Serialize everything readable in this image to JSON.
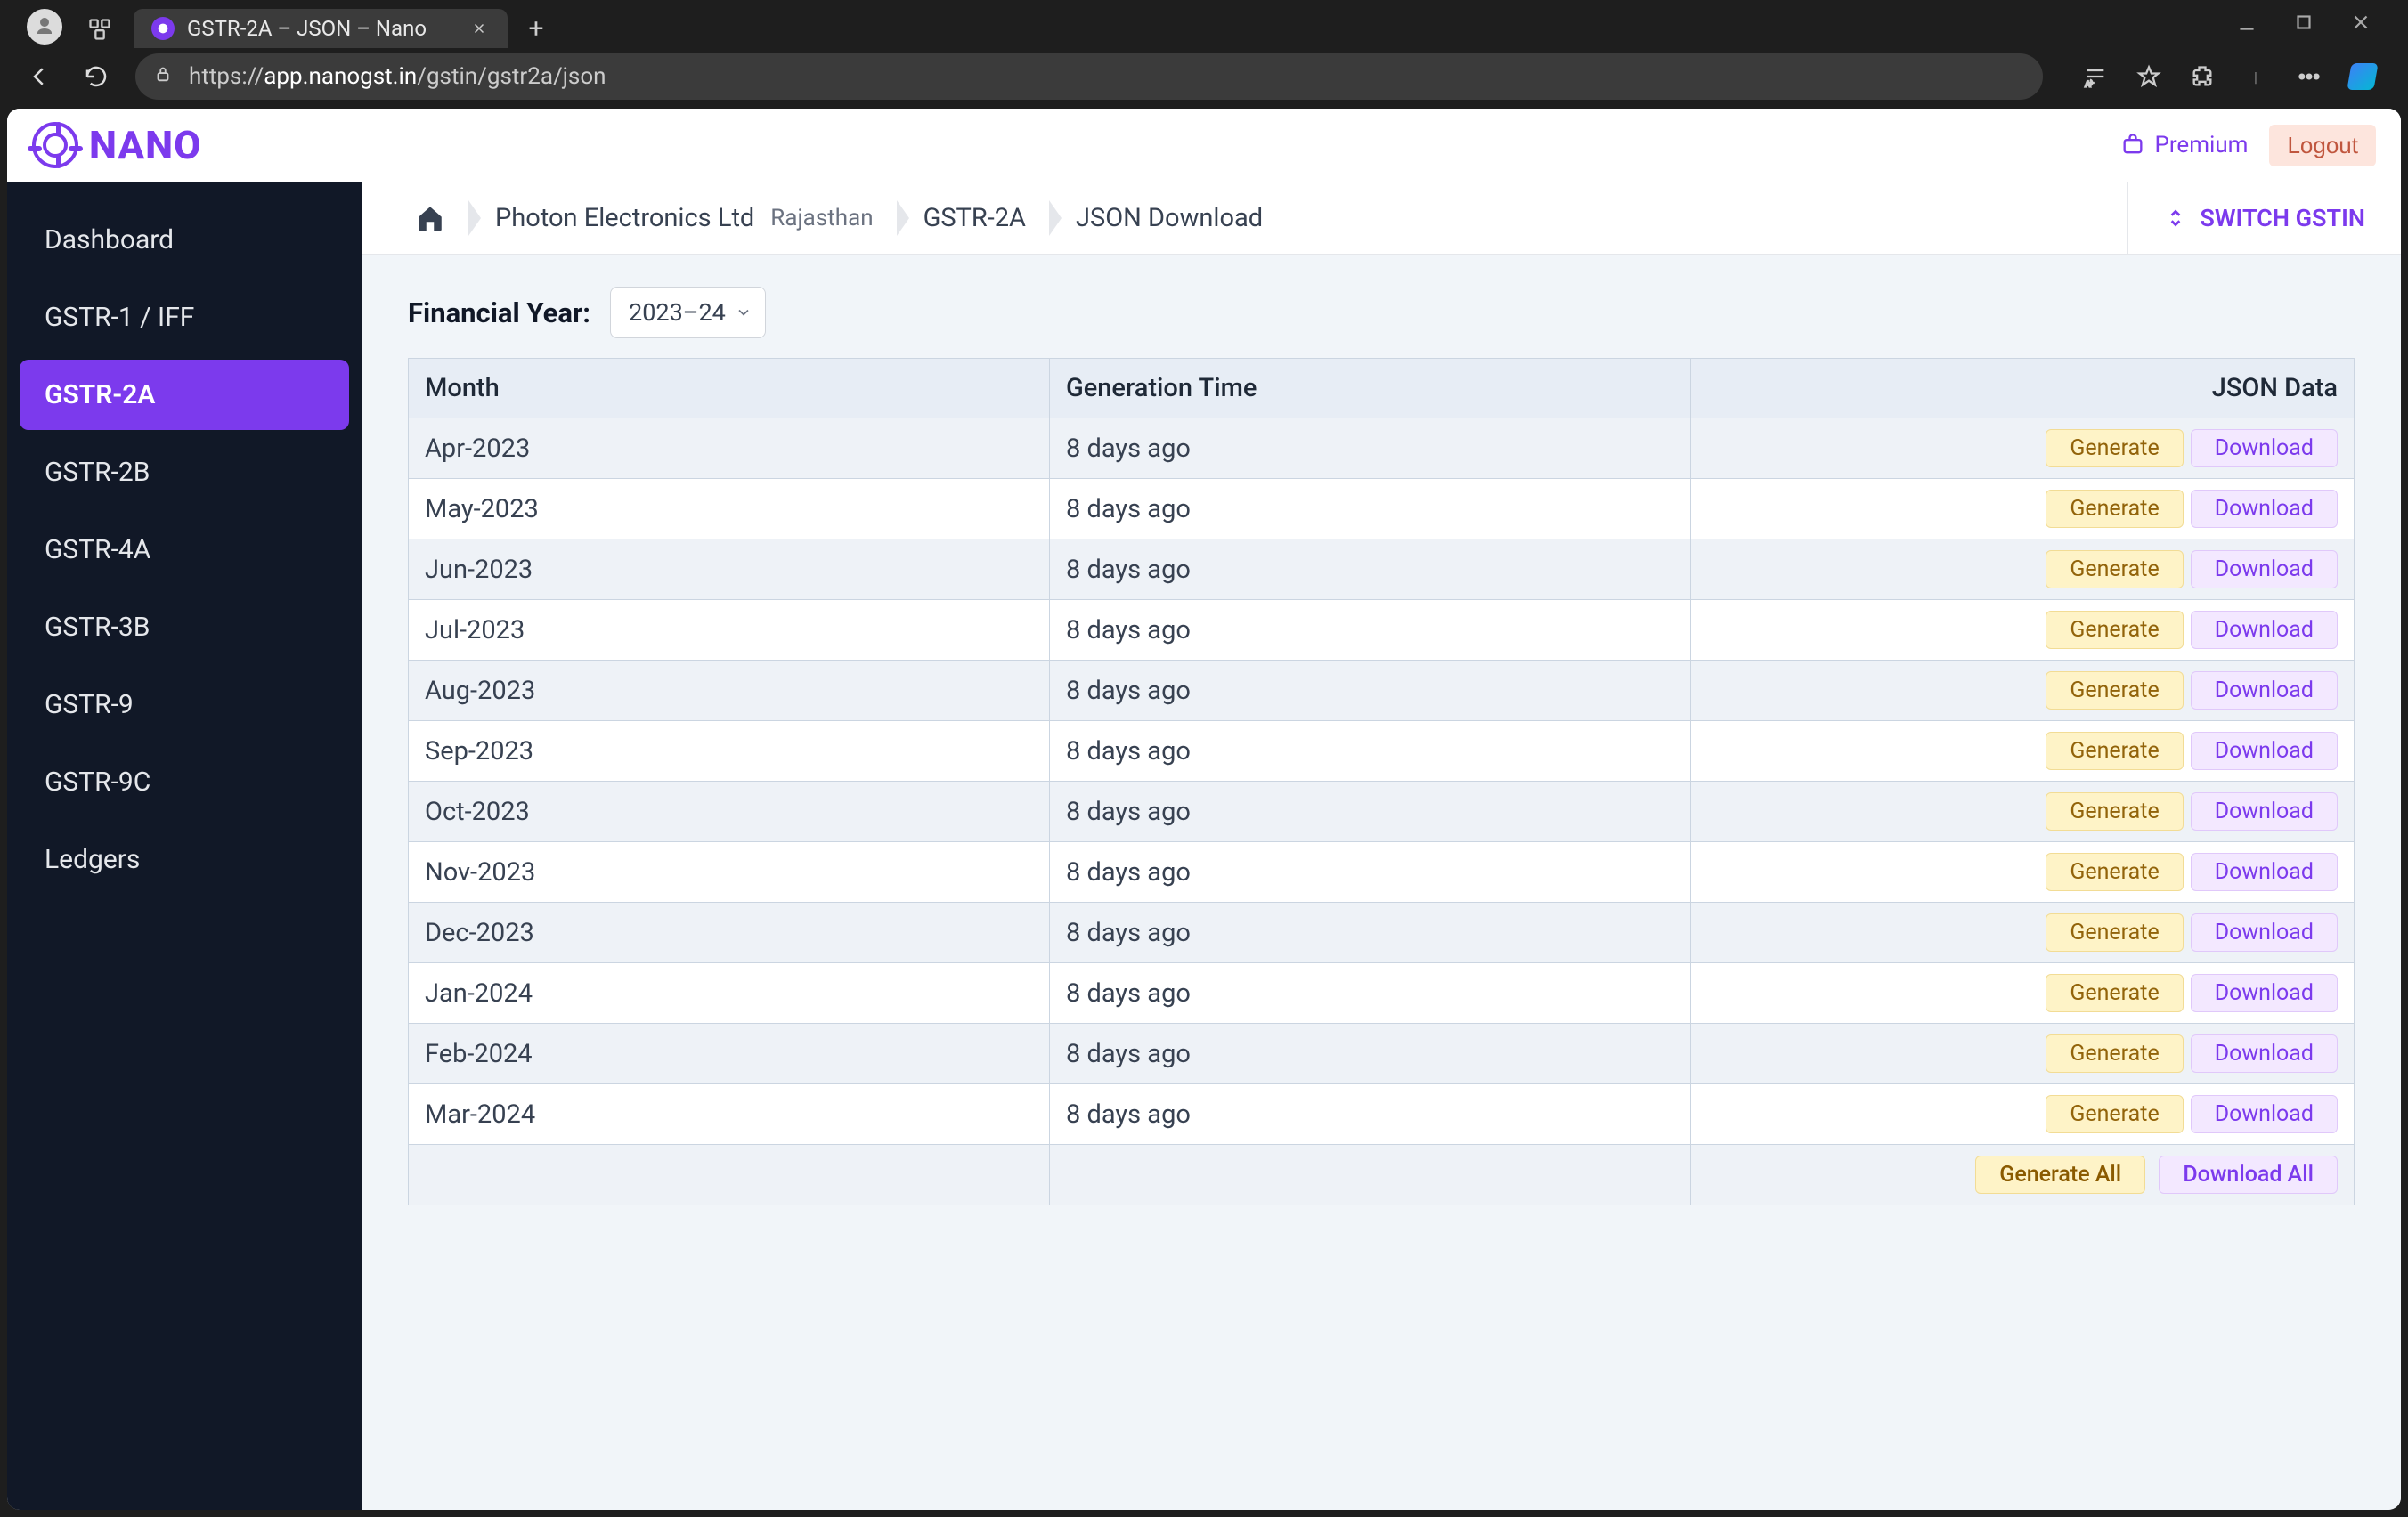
{
  "browser": {
    "tab_title": "GSTR-2A – JSON – Nano",
    "url_scheme": "https://",
    "url_host": "app.nanogst.in",
    "url_path": "/gstin/gstr2a/json"
  },
  "header": {
    "brand": "NANO",
    "premium": "Premium",
    "logout": "Logout"
  },
  "sidebar": {
    "items": [
      {
        "label": "Dashboard",
        "active": false
      },
      {
        "label": "GSTR-1 / IFF",
        "active": false
      },
      {
        "label": "GSTR-2A",
        "active": true
      },
      {
        "label": "GSTR-2B",
        "active": false
      },
      {
        "label": "GSTR-4A",
        "active": false
      },
      {
        "label": "GSTR-3B",
        "active": false
      },
      {
        "label": "GSTR-9",
        "active": false
      },
      {
        "label": "GSTR-9C",
        "active": false
      },
      {
        "label": "Ledgers",
        "active": false
      }
    ]
  },
  "breadcrumb": {
    "company": "Photon Electronics Ltd",
    "state": "Rajasthan",
    "return": "GSTR-2A",
    "page": "JSON Download",
    "switch": "SWITCH GSTIN"
  },
  "fy": {
    "label": "Financial Year:",
    "value": "2023–24"
  },
  "table": {
    "headers": {
      "month": "Month",
      "gen": "Generation Time",
      "json": "JSON Data"
    },
    "rows": [
      {
        "month": "Apr-2023",
        "gen": "8 days ago"
      },
      {
        "month": "May-2023",
        "gen": "8 days ago"
      },
      {
        "month": "Jun-2023",
        "gen": "8 days ago"
      },
      {
        "month": "Jul-2023",
        "gen": "8 days ago"
      },
      {
        "month": "Aug-2023",
        "gen": "8 days ago"
      },
      {
        "month": "Sep-2023",
        "gen": "8 days ago"
      },
      {
        "month": "Oct-2023",
        "gen": "8 days ago"
      },
      {
        "month": "Nov-2023",
        "gen": "8 days ago"
      },
      {
        "month": "Dec-2023",
        "gen": "8 days ago"
      },
      {
        "month": "Jan-2024",
        "gen": "8 days ago"
      },
      {
        "month": "Feb-2024",
        "gen": "8 days ago"
      },
      {
        "month": "Mar-2024",
        "gen": "8 days ago"
      }
    ],
    "buttons": {
      "generate": "Generate",
      "download": "Download",
      "generate_all": "Generate All",
      "download_all": "Download All"
    }
  }
}
